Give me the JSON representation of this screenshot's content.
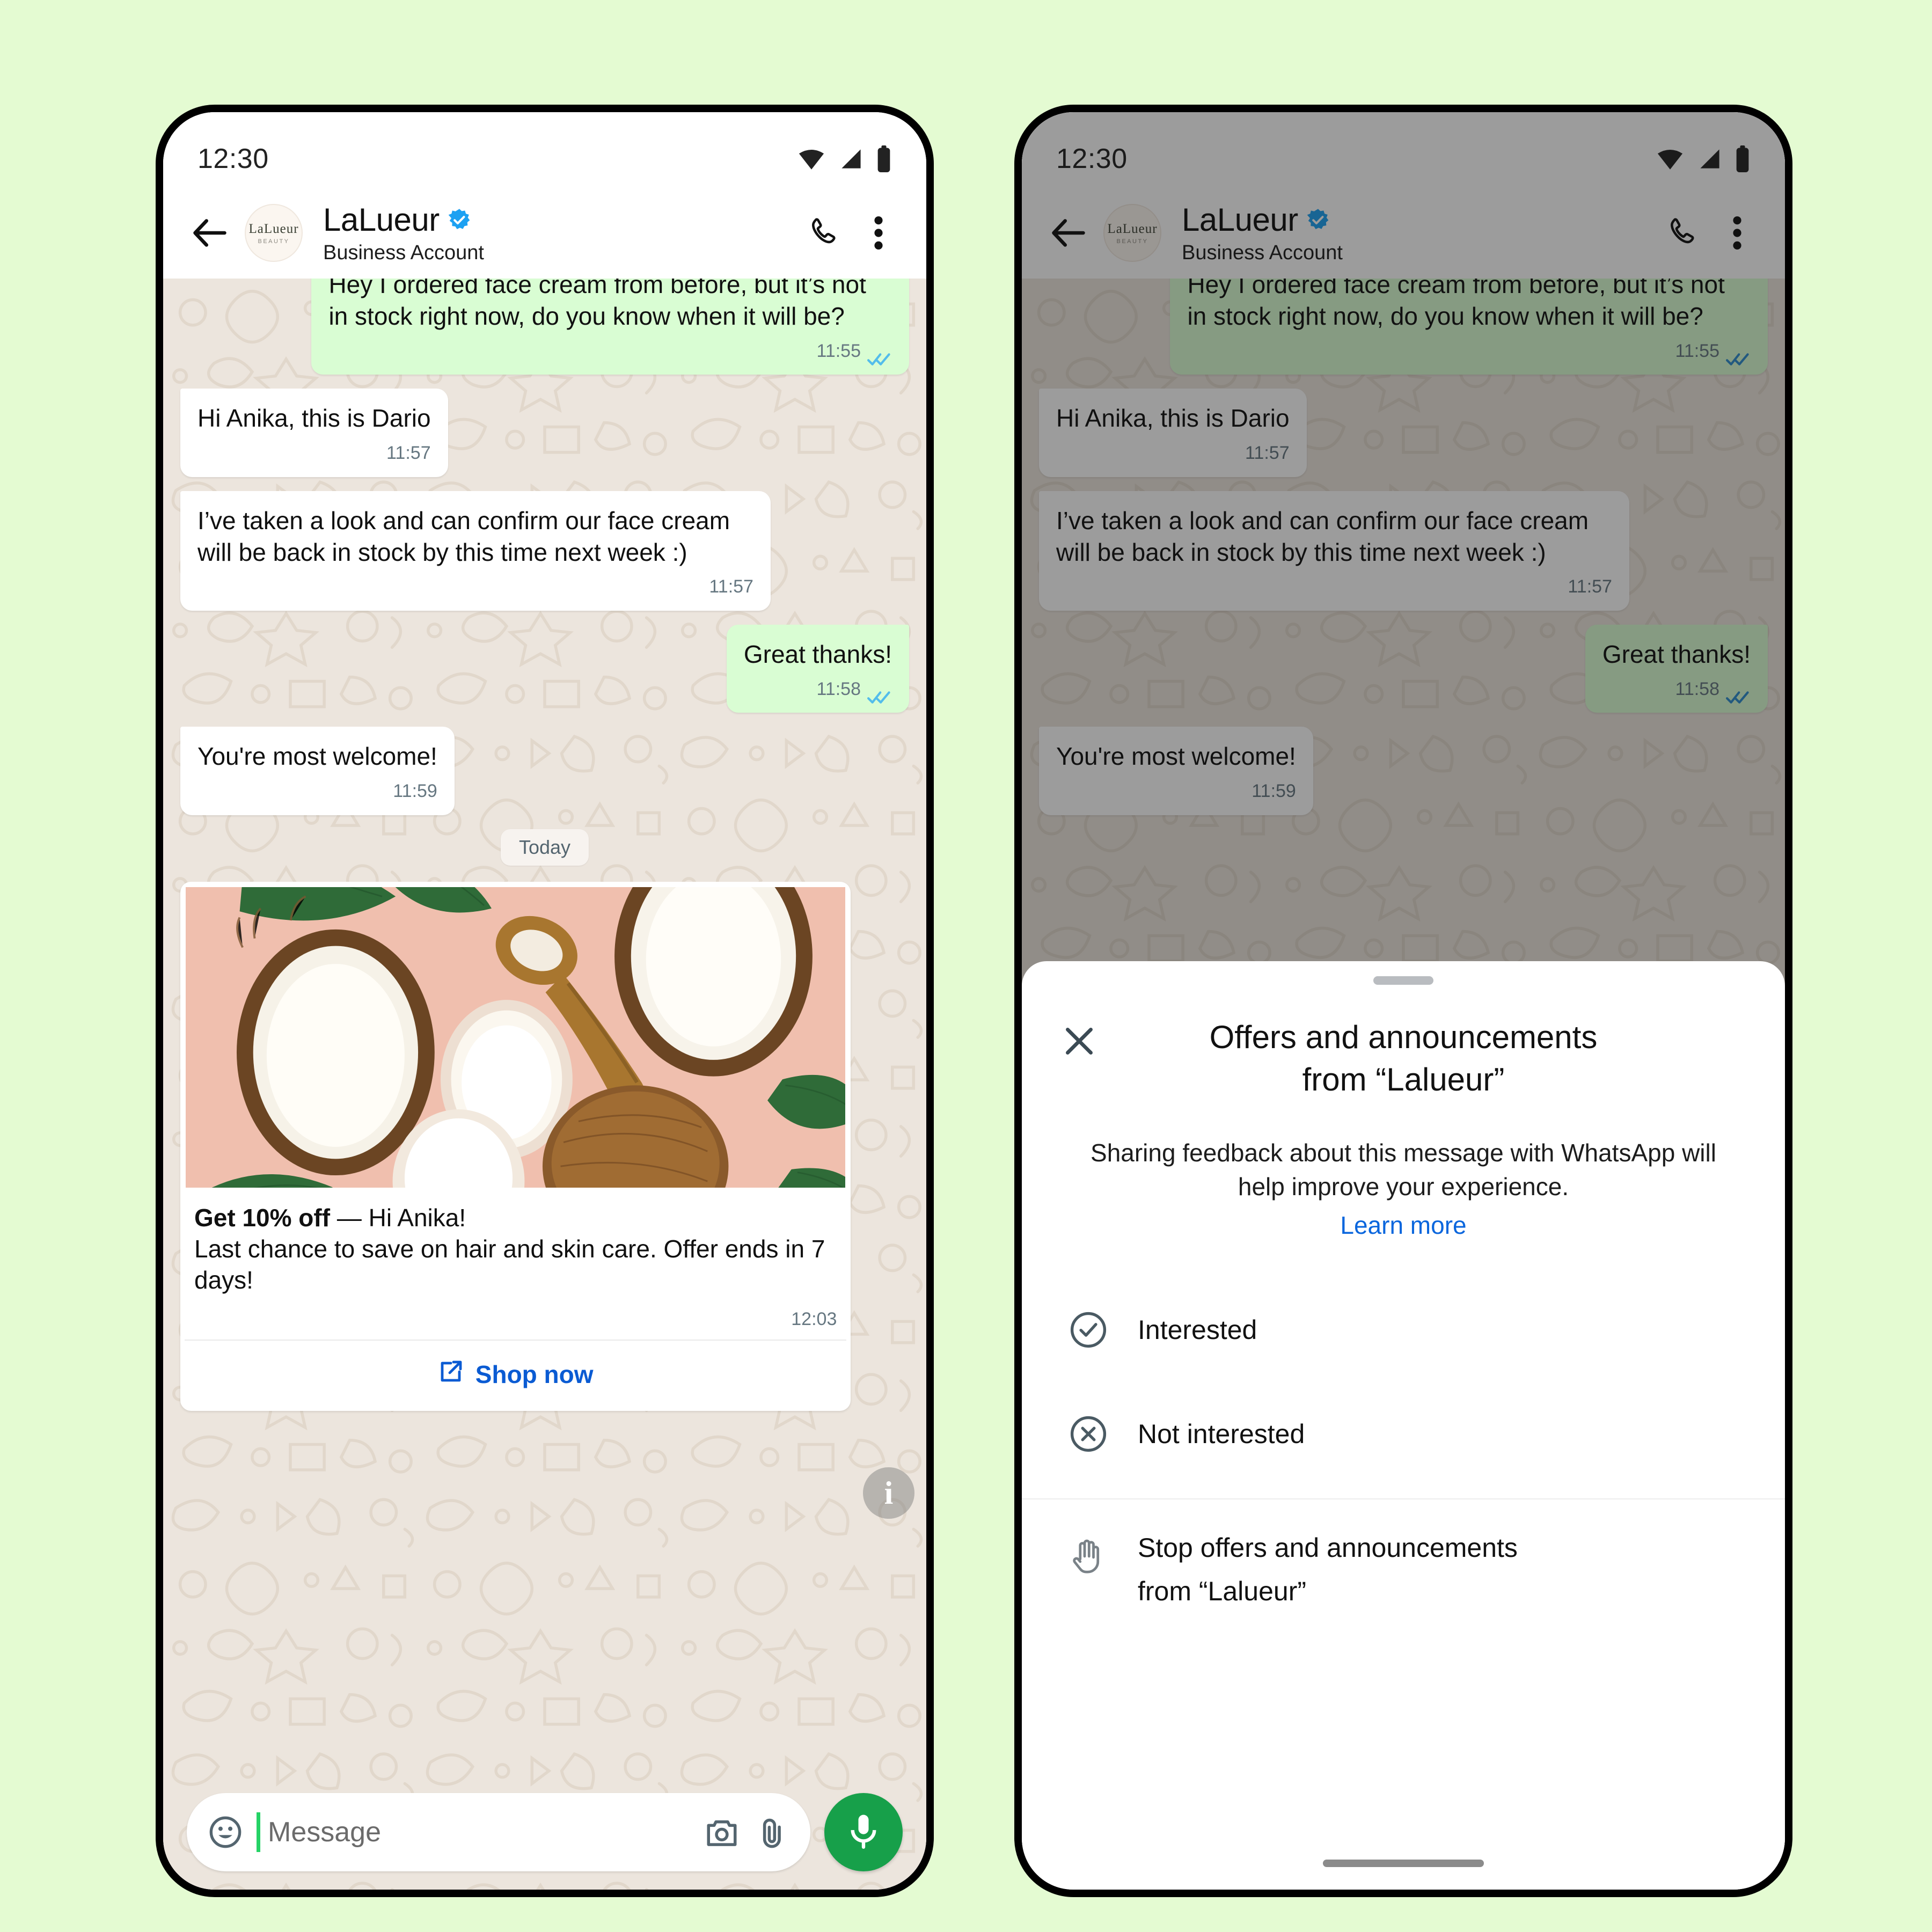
{
  "page": {
    "background": "#e4fbd2"
  },
  "status": {
    "time": "12:30",
    "icons": [
      "wifi-icon",
      "cellular-signal-icon",
      "battery-icon"
    ]
  },
  "header": {
    "back": "back-arrow-icon",
    "avatar": {
      "name": "LaLueur",
      "sub": "BEAUTY"
    },
    "title": "LaLueur",
    "verified_badge": "verified-badge-icon",
    "subtitle": "Business Account",
    "actions": [
      "call-icon",
      "overflow-menu-icon"
    ]
  },
  "chat": {
    "messages": [
      {
        "id": "m1",
        "direction": "out",
        "text": "Hey I ordered face cream from before, but it’s not in stock right now, do you know when it will be?",
        "time": "11:55",
        "status": "read",
        "clipped": true
      },
      {
        "id": "m2",
        "direction": "in",
        "text": "Hi Anika, this is Dario",
        "time": "11:57",
        "status": "none",
        "clipped": false
      },
      {
        "id": "m3",
        "direction": "in",
        "text": "I’ve taken a look and can confirm our face cream will be back in stock by this time next week :)",
        "time": "11:57",
        "status": "none",
        "clipped": false
      },
      {
        "id": "m4",
        "direction": "out",
        "text": "Great thanks!",
        "time": "11:58",
        "status": "read",
        "clipped": false
      },
      {
        "id": "m5",
        "direction": "in",
        "text": "You're most welcome!",
        "time": "11:59",
        "status": "none",
        "clipped": false
      }
    ],
    "date_divider": "Today",
    "info_badge": "i"
  },
  "promo_card": {
    "image_alt": "coconut-and-skincare-products-photo",
    "headline_bold": "Get 10% off",
    "headline_rest": " — Hi Anika!",
    "body": "Last chance to save on hair and skin care. Offer ends in 7 days!",
    "time": "12:03",
    "cta_label": "Shop now",
    "cta_icon": "external-link-icon",
    "cta_color": "#0a5bd3"
  },
  "composer": {
    "emoji_icon": "emoji-smiley-icon",
    "placeholder": "Message",
    "value": "",
    "camera_icon": "camera-icon",
    "attach_icon": "paperclip-icon",
    "mic_icon": "microphone-icon",
    "mic_color": "#17a04a"
  },
  "sheet": {
    "handle": "drag-handle",
    "close_icon": "close-icon",
    "title_line1": "Offers and announcements",
    "title_line2": "from “Lalueur”",
    "description": "Sharing feedback about this message with WhatsApp will help improve your experience.",
    "learn_more": "Learn more",
    "learn_more_color": "#0a66dd",
    "options": [
      {
        "id": "interested",
        "icon": "check-circle-icon",
        "label": "Interested"
      },
      {
        "id": "not-interested",
        "icon": "x-circle-icon",
        "label": "Not interested"
      }
    ],
    "stop_option": {
      "icon": "raised-hand-icon",
      "label_line1": "Stop offers and announcements",
      "label_line2": "from “Lalueur”"
    }
  }
}
